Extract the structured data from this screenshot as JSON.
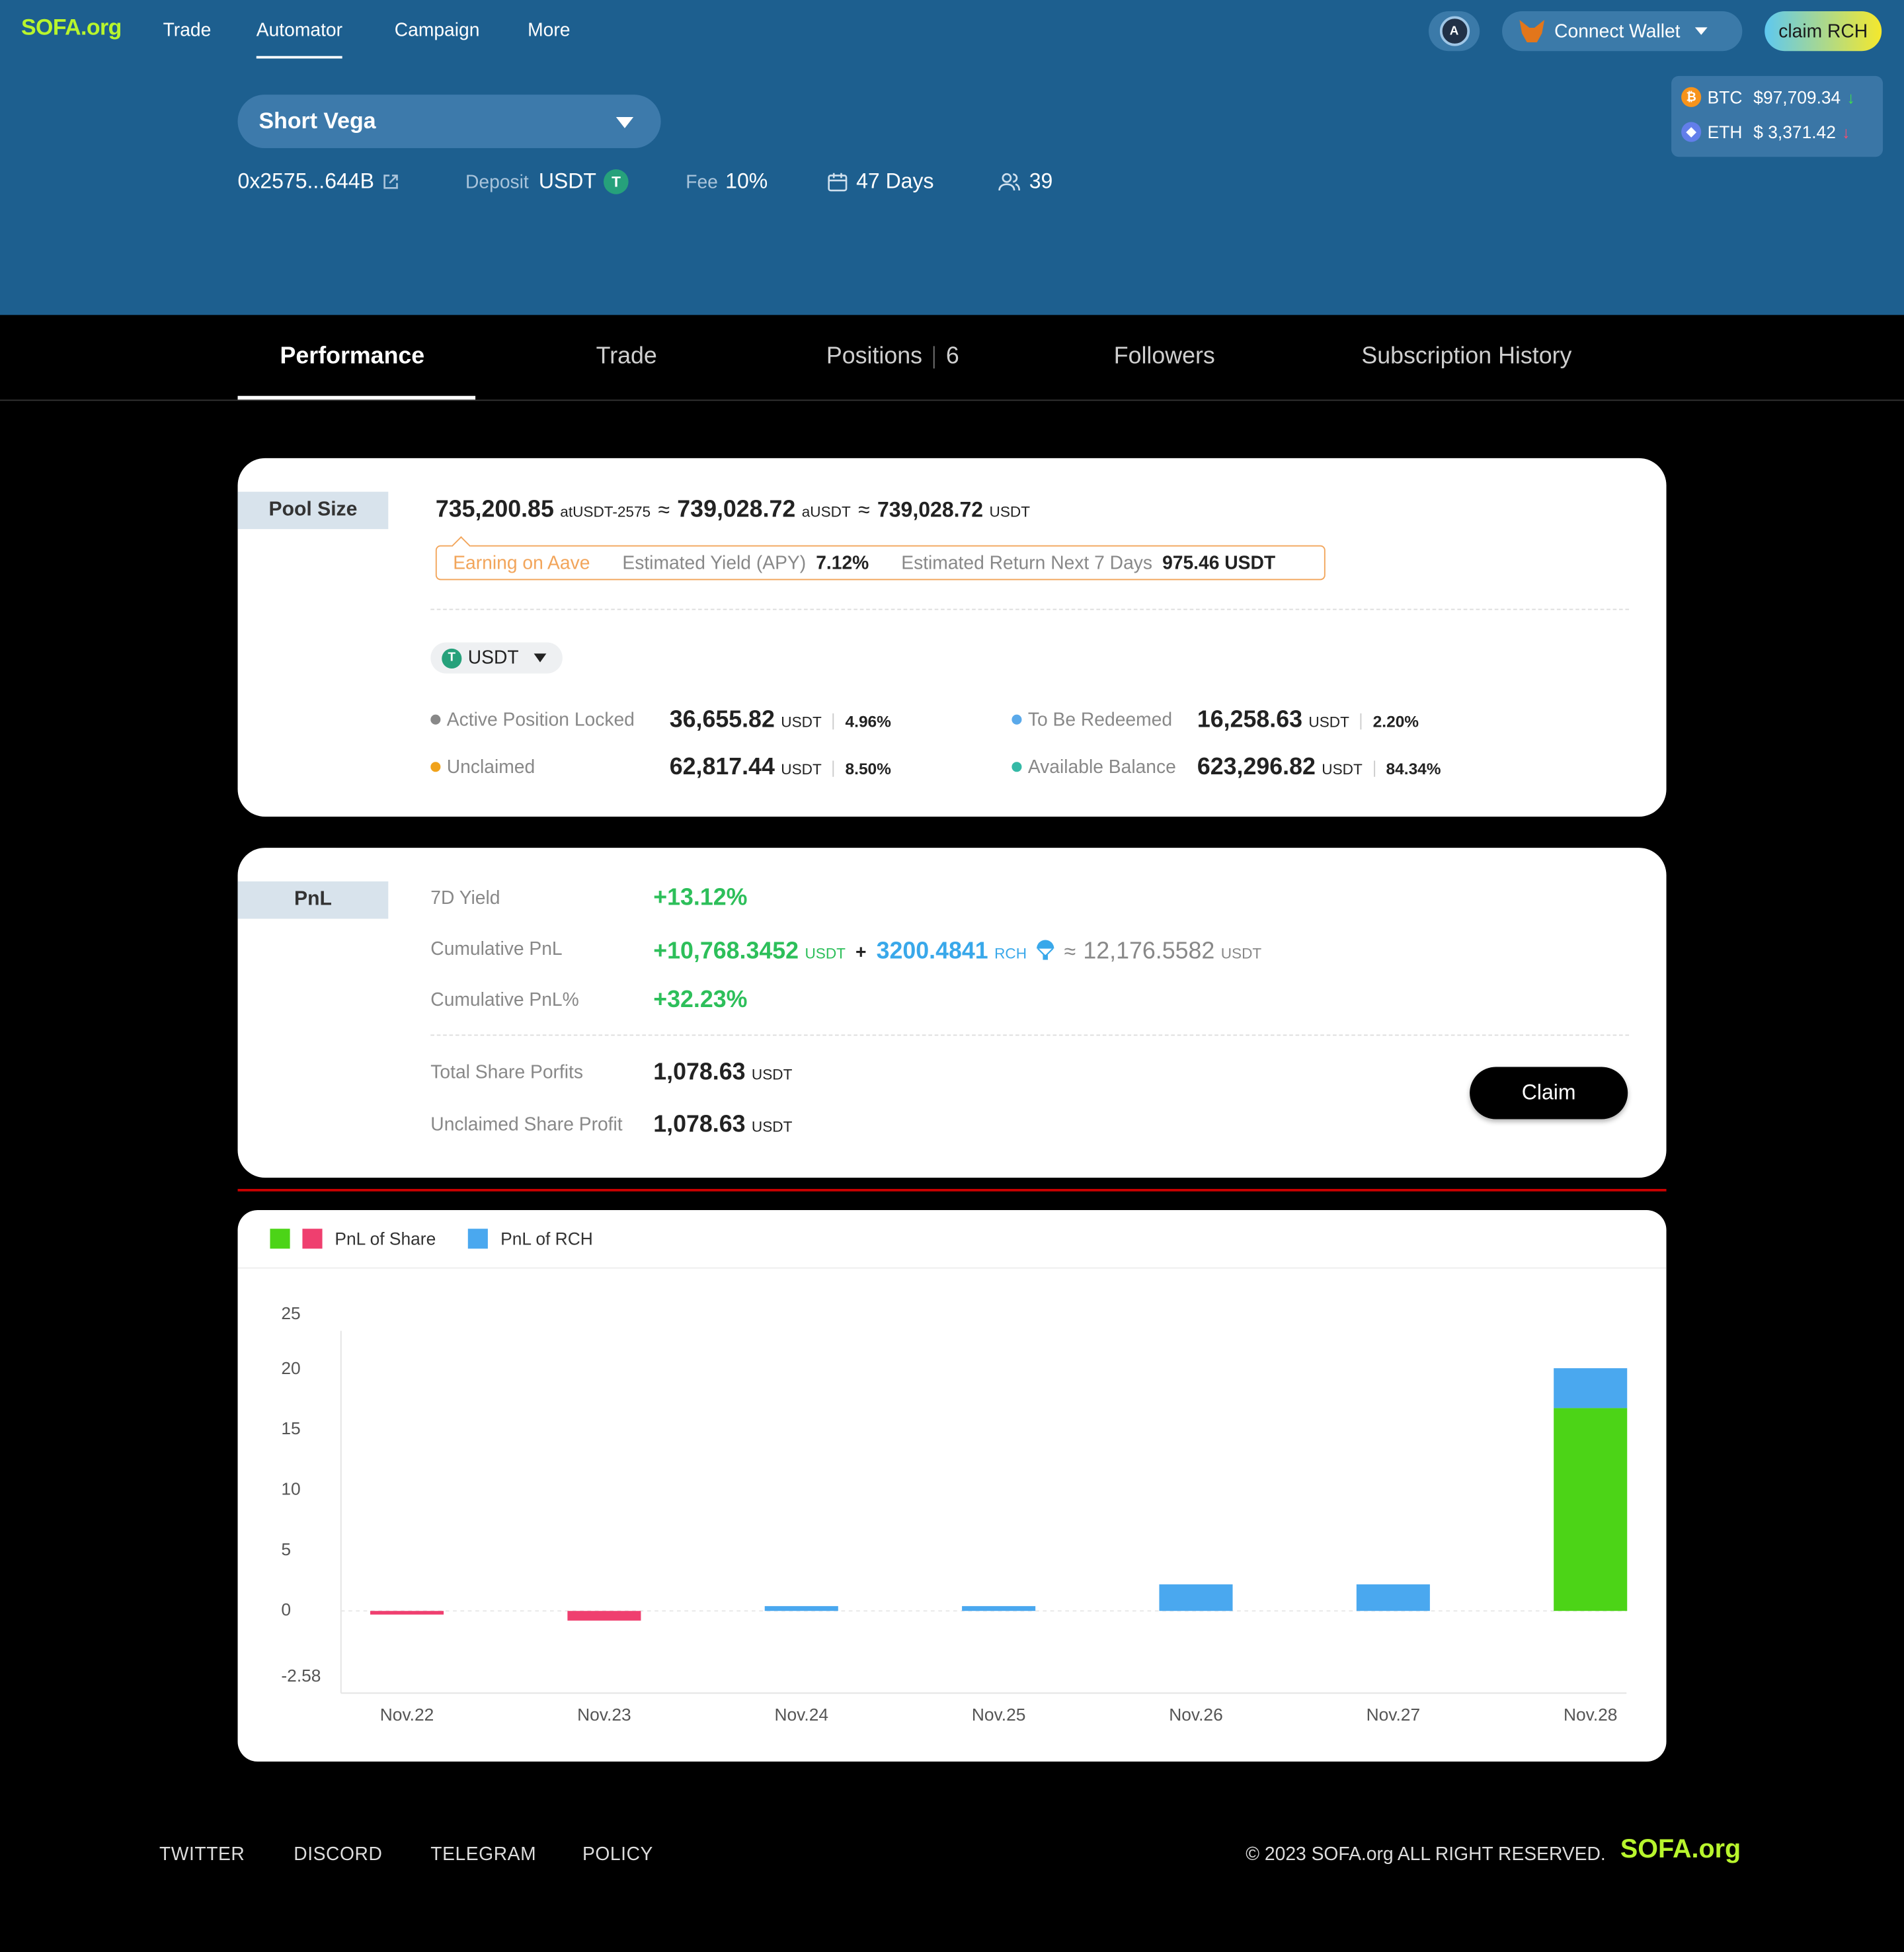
{
  "header": {
    "logo": "SOFA.org",
    "nav": [
      "Trade",
      "Automator",
      "Campaign",
      "More"
    ],
    "wallet_label": "Connect Wallet",
    "claim_rch": "claim RCH",
    "prices": {
      "btc_symbol": "BTC",
      "btc_price": "$97,709.34",
      "eth_symbol": "ETH",
      "eth_price": "$ 3,371.42"
    }
  },
  "strategy": {
    "name": "Short Vega",
    "address": "0x2575...644B",
    "deposit_label": "Deposit",
    "deposit_token": "USDT",
    "fee_label": "Fee",
    "fee_value": "10%",
    "days": "47 Days",
    "followers": "39"
  },
  "tabs": {
    "performance": "Performance",
    "trade": "Trade",
    "positions": "Positions",
    "positions_count": "6",
    "followers": "Followers",
    "history": "Subscription History"
  },
  "pool": {
    "tag": "Pool Size",
    "v1": "735,200.85",
    "u1": "atUSDT-2575",
    "approx": "≈",
    "v2": "739,028.72",
    "u2": "aUSDT",
    "v3": "739,028.72",
    "u3": "USDT",
    "earning": "Earning on Aave",
    "apy_label": "Estimated Yield (APY)",
    "apy": "7.12%",
    "return_label": "Estimated Return Next 7 Days",
    "return_value": "975.46 USDT",
    "token": "USDT",
    "active_label": "Active Position Locked",
    "active_value": "36,655.82",
    "active_pct": "4.96%",
    "redeem_label": "To Be Redeemed",
    "redeem_value": "16,258.63",
    "redeem_pct": "2.20%",
    "unclaimed_label": "Unclaimed",
    "unclaimed_value": "62,817.44",
    "unclaimed_pct": "8.50%",
    "avail_label": "Available Balance",
    "avail_value": "623,296.82",
    "avail_pct": "84.34%",
    "unit": "USDT",
    "dot_colors": {
      "active": "#888888",
      "redeem": "#5aa9ea",
      "unclaimed": "#f0a21a",
      "avail": "#34b9a6"
    }
  },
  "pnl": {
    "tag": "PnL",
    "yield_label": "7D Yield",
    "yield_value": "+13.12%",
    "cum_label": "Cumulative PnL",
    "cum_value": "+10,768.3452",
    "cum_unit": "USDT",
    "plus": "+",
    "rch_value": "3200.4841",
    "rch_unit": "RCH",
    "approx": "≈",
    "approx_value": "12,176.5582",
    "approx_unit": "USDT",
    "cum_pct_label": "Cumulative PnL%",
    "cum_pct_value": "+32.23%",
    "share_label": "Total Share Porfits",
    "share_value": "1,078.63",
    "share_unit": "USDT",
    "unclaimed_label": "Unclaimed Share Profit",
    "unclaimed_value": "1,078.63",
    "unclaimed_unit": "USDT",
    "claim_button": "Claim"
  },
  "chart_data": {
    "type": "bar",
    "legend": [
      "PnL of Share",
      "PnL of RCH"
    ],
    "colors": {
      "share_pos": "#4cd417",
      "share_neg": "#ef3f6f",
      "rch": "#4aa8ef"
    },
    "categories": [
      "Nov.22",
      "Nov.23",
      "Nov.24",
      "Nov.25",
      "Nov.26",
      "Nov.27",
      "Nov.28"
    ],
    "series": [
      {
        "name": "PnL of Share",
        "values": [
          -0.3,
          -0.8,
          0,
          0,
          0,
          0,
          16.8
        ]
      },
      {
        "name": "PnL of RCH",
        "values": [
          0,
          0,
          0.4,
          0.4,
          2.2,
          2.2,
          3.3
        ]
      }
    ],
    "yticks": [
      "25",
      "20",
      "15",
      "10",
      "5",
      "0",
      "-2.58"
    ],
    "ylim": [
      -2.58,
      25
    ],
    "grid": false
  },
  "footer": {
    "links": [
      "TWITTER",
      "DISCORD",
      "TELEGRAM",
      "POLICY"
    ],
    "copyright": "© 2023 SOFA.org ALL RIGHT RESERVED.",
    "logo": "SOFA.org"
  }
}
